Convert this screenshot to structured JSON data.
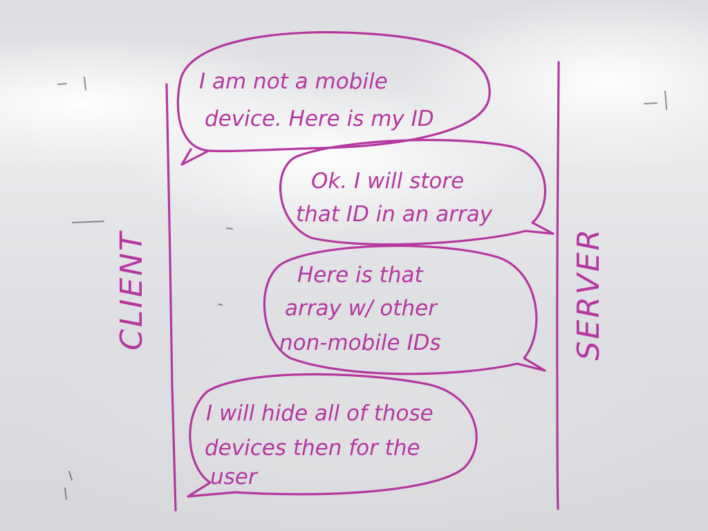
{
  "diagram": {
    "ink_color": "#b5379f",
    "actors": {
      "client": "CLIENT",
      "server": "SERVER"
    },
    "messages": [
      {
        "from": "client",
        "to": "server",
        "lines": [
          "I am not a mobile",
          "device. Here is my ID"
        ]
      },
      {
        "from": "server",
        "to": "client",
        "lines": [
          "Ok. I will store",
          "that ID in an array"
        ]
      },
      {
        "from": "server",
        "to": "client",
        "lines": [
          "Here is that",
          "array w/ other",
          "non-mobile IDs"
        ]
      },
      {
        "from": "client",
        "to": "server",
        "lines": [
          "I will hide all of those",
          "devices then for the",
          "user"
        ]
      }
    ]
  }
}
